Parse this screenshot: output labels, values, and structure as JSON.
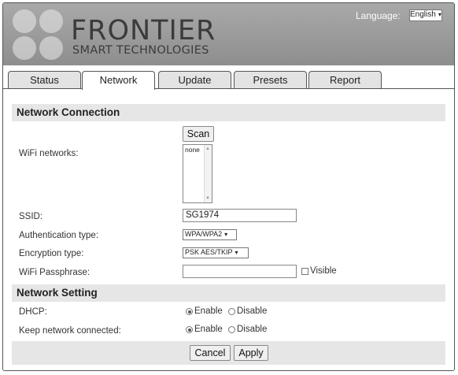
{
  "brand": {
    "name": "FRONTIER",
    "tagline": "SMART TECHNOLOGIES"
  },
  "language": {
    "label": "Language:",
    "selected": "English"
  },
  "tabs": [
    {
      "label": "Status"
    },
    {
      "label": "Network"
    },
    {
      "label": "Update"
    },
    {
      "label": "Presets"
    },
    {
      "label": "Report"
    }
  ],
  "network_connection": {
    "heading": "Network Connection",
    "scan_label": "Scan",
    "wifi_networks_label": "WiFi networks:",
    "wifi_networks_items": [
      "none"
    ],
    "ssid_label": "SSID:",
    "ssid_value": "SG1974",
    "auth_label": "Authentication type:",
    "auth_value": "WPA/WPA2",
    "enc_label": "Encryption type:",
    "enc_value": "PSK AES/TKIP",
    "pass_label": "WiFi Passphrase:",
    "pass_value": "",
    "visible_label": "Visible"
  },
  "network_setting": {
    "heading": "Network Setting",
    "dhcp_label": "DHCP:",
    "keep_label": "Keep network connected:",
    "enable_label": "Enable",
    "disable_label": "Disable",
    "dhcp_selected": "Enable",
    "keep_selected": "Enable"
  },
  "actions": {
    "cancel_label": "Cancel",
    "apply_label": "Apply"
  }
}
